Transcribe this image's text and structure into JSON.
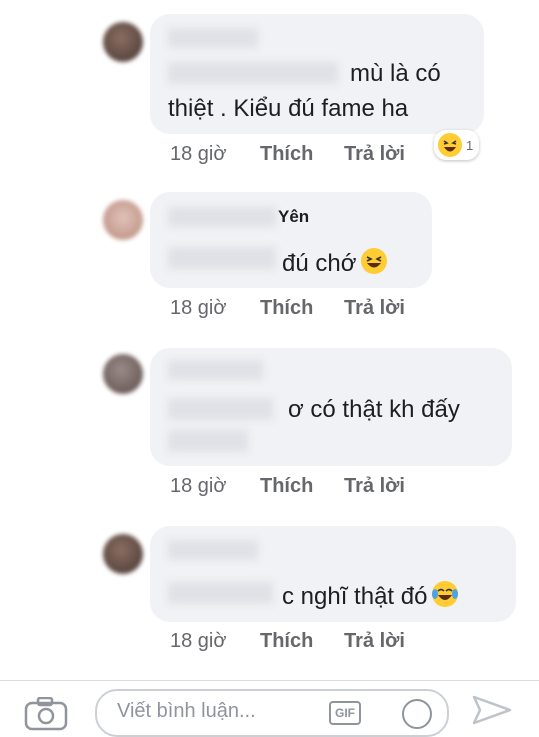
{
  "comments": [
    {
      "name": "",
      "text_line1": "mù là có",
      "text_line2": "thiệt . Kiểu đú fame ha",
      "time": "18 giờ",
      "like": "Thích",
      "reply": "Trả lời",
      "reaction": {
        "icon": "haha-reaction-icon",
        "count": "1"
      }
    },
    {
      "name": "Yên",
      "text_line1": "đú chớ",
      "emoji": "laughing-emoji-icon",
      "time": "18 giờ",
      "like": "Thích",
      "reply": "Trả lời"
    },
    {
      "text_line1": "ơ có thật kh đấy",
      "time": "18 giờ",
      "like": "Thích",
      "reply": "Trả lời"
    },
    {
      "text_line1": "c nghĩ thật đó",
      "emoji": "tears-of-joy-emoji-icon",
      "time": "18 giờ",
      "like": "Thích",
      "reply": "Trả lời"
    }
  ],
  "composer": {
    "placeholder": "Viết bình luận...",
    "gif_label": "GIF",
    "camera_icon": "camera-icon",
    "send_icon": "send-icon",
    "sticker_icon": "sticker-icon"
  },
  "colors": {
    "bubble": "#f0f2f5",
    "meta": "#65676b",
    "text": "#1c1e21"
  }
}
